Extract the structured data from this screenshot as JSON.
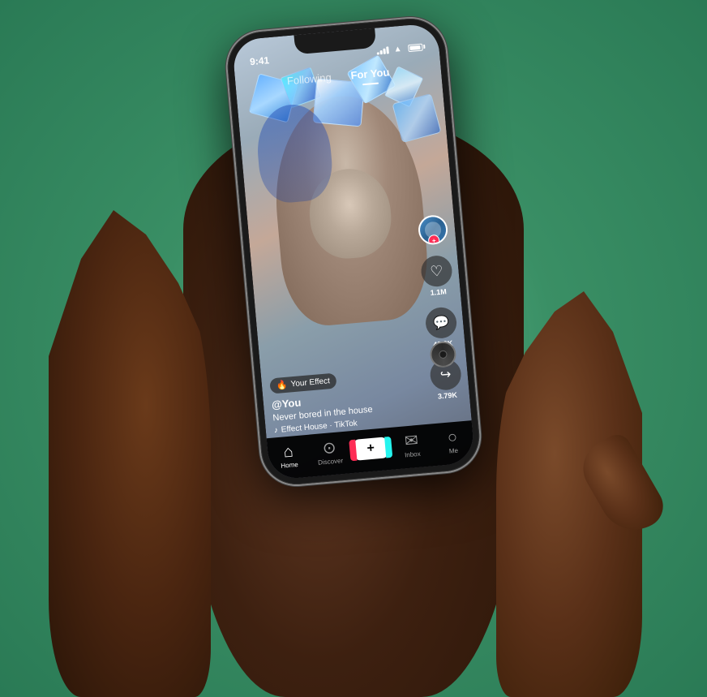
{
  "app": {
    "name": "TikTok"
  },
  "statusBar": {
    "time": "9:41",
    "signalBars": 4,
    "battery": 80
  },
  "navigation": {
    "tabs": [
      {
        "id": "following",
        "label": "Following",
        "active": false
      },
      {
        "id": "foryou",
        "label": "For You",
        "active": true
      }
    ]
  },
  "video": {
    "username": "@You",
    "caption": "Never bored in the house",
    "music": "Effect House · TikTok",
    "effect": "Your Effect",
    "effectEmoji": "🔥"
  },
  "actions": {
    "likes": "1.1M",
    "comments": "43.8K",
    "shares": "3.79K"
  },
  "bottomNav": {
    "items": [
      {
        "id": "home",
        "label": "Home",
        "active": true,
        "icon": "⌂"
      },
      {
        "id": "discover",
        "label": "Discover",
        "active": false,
        "icon": "🔍"
      },
      {
        "id": "create",
        "label": "",
        "active": false,
        "icon": "+"
      },
      {
        "id": "inbox",
        "label": "Inbox",
        "active": false,
        "icon": "✉"
      },
      {
        "id": "me",
        "label": "Me",
        "active": false,
        "icon": "👤"
      }
    ]
  }
}
